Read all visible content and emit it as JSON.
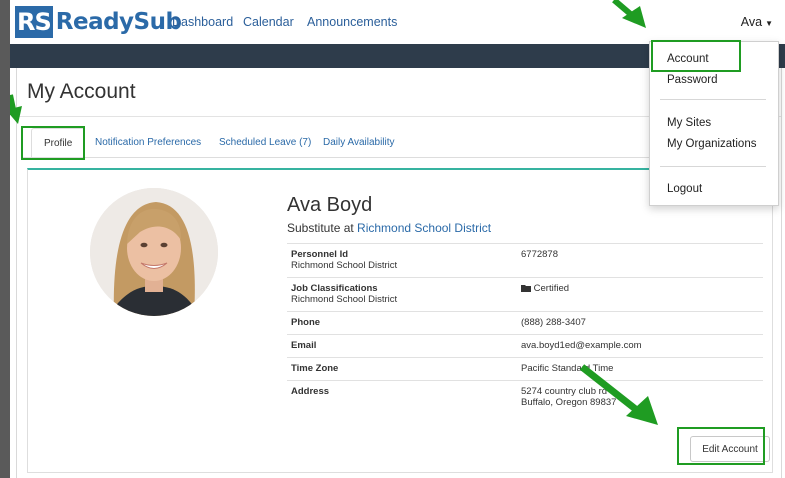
{
  "brand": {
    "logo_mark": "RS",
    "logo_text": "ReadySub"
  },
  "nav": {
    "links": [
      "Dashboard",
      "Calendar",
      "Announcements"
    ],
    "user": "Ava"
  },
  "user_dropdown": {
    "items": [
      "Account",
      "Password",
      "My Sites",
      "My Organizations",
      "Logout"
    ]
  },
  "page": {
    "title": "My Account"
  },
  "tabs": [
    "Profile",
    "Notification Preferences",
    "Scheduled Leave (7)",
    "Daily Availability"
  ],
  "profile": {
    "name": "Ava Boyd",
    "subtitle_prefix": "Substitute at ",
    "district": "Richmond School District",
    "avatar_icon": "user-photo",
    "fields": [
      {
        "label": "Personnel Id",
        "sub": "Richmond School District",
        "value": "6772878",
        "value2": ""
      },
      {
        "label": "Job Classifications",
        "sub": "Richmond School District",
        "value": "Certified",
        "value2": ""
      },
      {
        "label": "Phone",
        "sub": "",
        "value": "(888) 288-3407",
        "value2": ""
      },
      {
        "label": "Email",
        "sub": "",
        "value": "ava.boyd1ed@example.com",
        "value2": ""
      },
      {
        "label": "Time Zone",
        "sub": "",
        "value": "Pacific Standard Time",
        "value2": ""
      },
      {
        "label": "Address",
        "sub": "",
        "value": "5274 country club rd",
        "value2": "Buffalo, Oregon 89837"
      }
    ],
    "folder_icon": "folder-icon"
  },
  "actions": {
    "edit_account": "Edit Account"
  },
  "colors": {
    "brand_blue": "#2b6aa8",
    "navbar_band": "#2e3c4b",
    "panel_accent": "#36b3a0",
    "annotation_green": "#1f9c22"
  }
}
